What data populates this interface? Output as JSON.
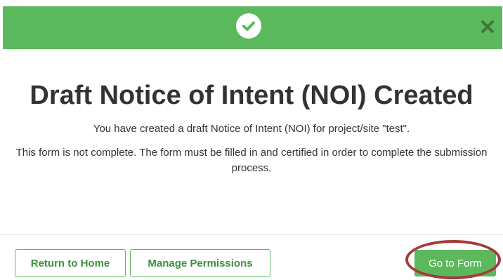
{
  "modal": {
    "header": {
      "status_icon": "check-circle-icon",
      "close_icon": "close-icon",
      "header_color": "#5cb85c"
    },
    "title": "Draft Notice of Intent (NOI) Created",
    "message_line1": "You have created a draft Notice of Intent (NOI) for project/site \"test\".",
    "message_line2": "This form is not complete. The form must be filled in and certified in order to complete the submission process.",
    "footer": {
      "return_home_label": "Return to Home",
      "manage_permissions_label": "Manage Permissions",
      "go_to_form_label": "Go to Form"
    }
  }
}
